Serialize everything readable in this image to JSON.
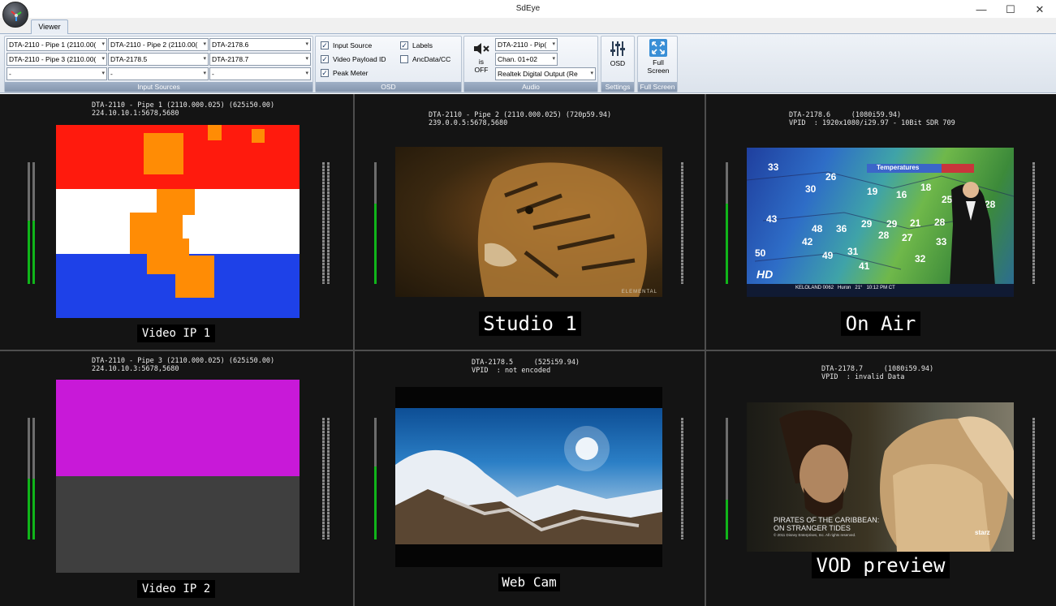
{
  "window": {
    "title": "SdEye",
    "minimize": "—",
    "maximize": "☐",
    "close": "✕"
  },
  "ribbon": {
    "tab": "Viewer",
    "input_sources": {
      "label": "Input Sources",
      "combos": [
        "DTA-2110 - Pipe 1 (2110.00(",
        "DTA-2110 - Pipe 2 (2110.00(",
        "DTA-2178.6",
        "DTA-2110 - Pipe 3 (2110.00(",
        "DTA-2178.5",
        "DTA-2178.7",
        "-",
        "-",
        "-"
      ]
    },
    "osd": {
      "label": "OSD",
      "input_source": "Input Source",
      "input_source_checked": true,
      "video_payload_id": "Video Payload ID",
      "video_payload_id_checked": true,
      "peak_meter": "Peak Meter",
      "peak_meter_checked": true,
      "labels": "Labels",
      "labels_checked": true,
      "anc_data": "AncData/CC",
      "anc_data_checked": false
    },
    "audio": {
      "label": "Audio",
      "mute_line1": "is",
      "mute_line2": "OFF",
      "source": "DTA-2110 - Pip(",
      "channel": "Chan. 01+02",
      "output": "Realtek Digital Output (Re"
    },
    "settings": {
      "label": "Settings",
      "osd_button": "OSD"
    },
    "fullscreen": {
      "label": "Full Screen",
      "button_line1": "Full",
      "button_line2": "Screen"
    }
  },
  "tiles": [
    {
      "info": "DTA-2110 - Pipe 1 (2110.000.025) (625i50.00)\n224.10.10.1:5678,5680",
      "label": "Video IP 1",
      "meter": 0.52
    },
    {
      "info": "DTA-2110 - Pipe 2 (2110.000.025) (720p59.94)\n239.0.0.5:5678,5680",
      "label": "Studio 1",
      "meter": 0.66
    },
    {
      "info": "DTA-2178.6     (1080i59.94)\nVPID  : 1920x1080/i29.97 - 10Bit SDR 709",
      "label": "On Air",
      "meter": 0.66
    },
    {
      "info": "DTA-2110 - Pipe 3 (2110.000.025) (625i50.00)\n224.10.10.3:5678,5680",
      "label": "Video IP 2",
      "meter": 0.5
    },
    {
      "info": "DTA-2178.5     (525i59.94)\nVPID  : not encoded",
      "label": "Web Cam",
      "meter": 0.6
    },
    {
      "info": "DTA-2178.7     (1080i59.94)\nVPID  : invalid Data",
      "label": "VOD preview",
      "meter": 0.33
    }
  ],
  "content": {
    "weather_title": "Temperatures",
    "weather_badge": "HD",
    "weather_ticker": "KELOLAND 0062   Huron   21°   10:12 PM CT",
    "movie_caption_1": "PIRATES OF THE CARIBBEAN:",
    "movie_caption_2": "ON STRANGER TIDES",
    "movie_copyright": "© 2011 Disney Enterprises, Inc. All rights reserved.",
    "movie_logo": "starz",
    "tiger_watermark": "ELEMENTAL"
  },
  "colors": {
    "meter_green": "#10b51a",
    "flag_red": "#ff1a0d",
    "flag_blue": "#1e41e8",
    "flag_orange": "#ff8c05",
    "magenta": "#c819d8"
  }
}
